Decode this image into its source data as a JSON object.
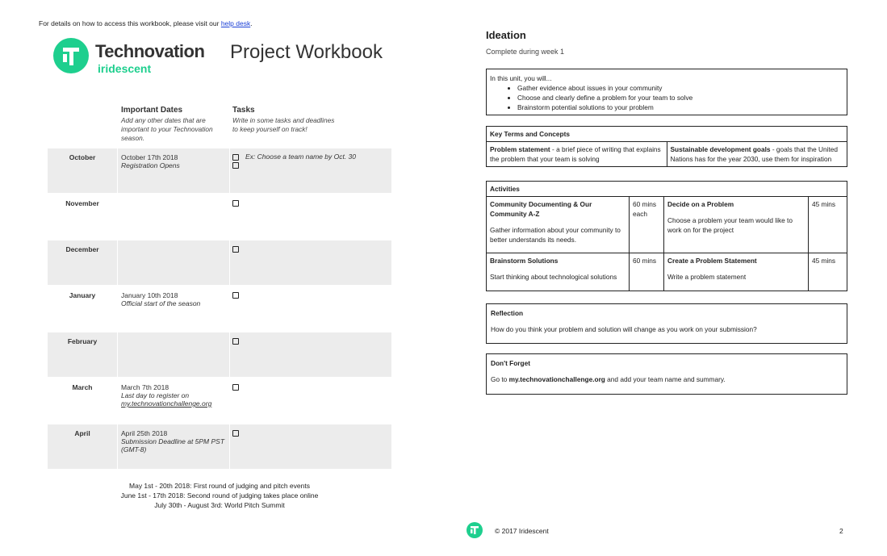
{
  "top_note": {
    "text": "For details on how to access this workbook, please visit our ",
    "link": "help desk",
    "end": "."
  },
  "brand": {
    "name": "Technovation",
    "sub": "iridescent"
  },
  "workbook_title": "Project Workbook",
  "columns": {
    "dates_head": "Important Dates",
    "dates_sub": "Add any other dates that are important to your Technovation season.",
    "tasks_head": "Tasks",
    "tasks_sub": "Write in some tasks and deadlines to keep yourself on track!"
  },
  "months": [
    {
      "name": "October",
      "date": "October 17th 2018",
      "note": "Registration Opens",
      "task": "Ex: Choose a team name by Oct. 30",
      "extra_box": true
    },
    {
      "name": "November",
      "date": "",
      "note": "",
      "task": "",
      "extra_box": false
    },
    {
      "name": "December",
      "date": "",
      "note": "",
      "task": "",
      "extra_box": false
    },
    {
      "name": "January",
      "date": "January 10th 2018",
      "note": "Official start of the season",
      "task": "",
      "extra_box": false
    },
    {
      "name": "February",
      "date": "",
      "note": "",
      "task": "",
      "extra_box": false
    },
    {
      "name": "March",
      "date": "March 7th 2018",
      "note": "Last day to register on",
      "link": "my.technovationchallenge.org",
      "task": "",
      "extra_box": false
    },
    {
      "name": "April",
      "date": "April 25th 2018",
      "note": "Submission Deadline at 5PM PST (GMT-8)",
      "task": "",
      "extra_box": false
    }
  ],
  "judging": [
    "May 1st - 20th 2018: First round of judging and pitch events",
    "June 1st - 17th 2018: Second round of judging takes place online",
    "July 30th - August 3rd: World Pitch Summit"
  ],
  "ideation": {
    "title": "Ideation",
    "subtitle": "Complete during week 1",
    "intro": "In this unit, you will...",
    "goals": [
      "Gather evidence about issues in your community",
      "Choose and clearly define a problem for your team to solve",
      "Brainstorm potential solutions to your problem"
    ]
  },
  "key_terms": {
    "heading": "Key Terms and Concepts",
    "terms": [
      {
        "term": "Problem statement",
        "def": " - a brief piece of writing that explains the problem that your team is solving"
      },
      {
        "term": "Sustainable development goals",
        "def": " - goals that the United Nations has for the year 2030, use them for inspiration"
      }
    ]
  },
  "activities": {
    "heading": "Activities",
    "items": [
      {
        "title": "Community Documenting & Our Community A-Z",
        "time": "60 mins each",
        "desc": "Gather information about your community to better understands its needs."
      },
      {
        "title": "Decide on a Problem",
        "time": "45 mins",
        "desc": "Choose a problem your team would like to work on for the project"
      },
      {
        "title": "Brainstorm Solutions",
        "time": "60 mins",
        "desc": "Start thinking about technological solutions"
      },
      {
        "title": "Create a Problem Statement",
        "time": "45 mins",
        "desc": "Write a problem statement"
      }
    ]
  },
  "reflection": {
    "heading": "Reflection",
    "text": "How do you think your problem and solution will change as you work on your submission?"
  },
  "dont_forget": {
    "heading": "Don't Forget",
    "pre": "Go to ",
    "link": "my.technovationchallenge.org",
    "post": " and add your team name and summary."
  },
  "footer": {
    "copyright": "© 2017 Iridescent",
    "page": "2"
  },
  "colors": {
    "brand_green": "#1ecf8e",
    "row_shade": "#ececec",
    "link_blue": "#1a3fd6"
  }
}
